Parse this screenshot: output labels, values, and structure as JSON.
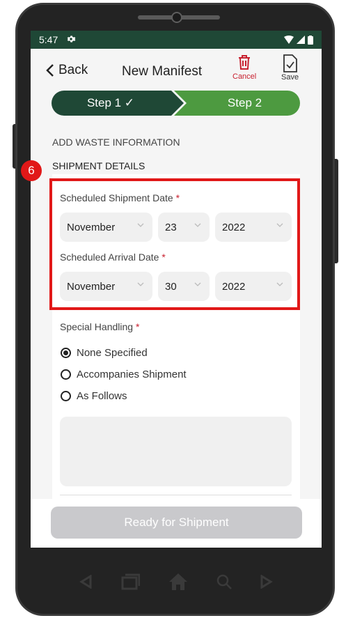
{
  "status_bar": {
    "time": "5:47"
  },
  "header": {
    "back_label": "Back",
    "title": "New Manifest",
    "cancel_label": "Cancel",
    "save_label": "Save"
  },
  "stepper": {
    "step1_label": "Step 1 ✓",
    "step2_label": "Step 2"
  },
  "sections": {
    "add_waste": "ADD WASTE INFORMATION",
    "shipment_details": "SHIPMENT DETAILS"
  },
  "callout_number": "6",
  "shipment_date": {
    "label": "Scheduled Shipment Date",
    "required": "*",
    "month": "November",
    "day": "23",
    "year": "2022"
  },
  "arrival_date": {
    "label": "Scheduled Arrival Date",
    "required": "*",
    "month": "November",
    "day": "30",
    "year": "2022"
  },
  "special_handling": {
    "label": "Special Handling",
    "required": "*",
    "options": [
      "None Specified",
      "Accompanies Shipment",
      "As Follows"
    ],
    "selected": "None Specified"
  },
  "ready_button": "Ready for Shipment",
  "colors": {
    "primary_dark": "#1f4836",
    "primary_green": "#4d9a40",
    "danger": "#c8202f",
    "highlight": "#e11818"
  }
}
